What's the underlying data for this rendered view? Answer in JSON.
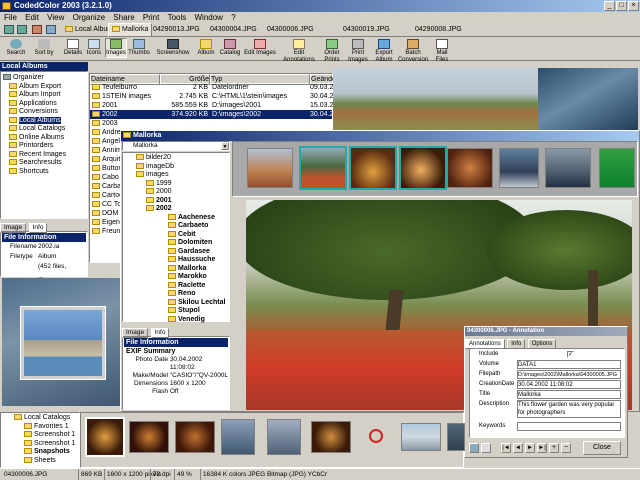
{
  "window": {
    "title": "CodedColor 2003 (3.2.1.0)"
  },
  "menu": [
    "File",
    "Edit",
    "View",
    "Organize",
    "Share",
    "Print",
    "Tools",
    "Window",
    "?"
  ],
  "tabs": [
    "Local Albums",
    "Mallorka",
    "04290013.JPG",
    "04300004.JPG",
    "04300006.JPG",
    "04300019.JPG",
    "04290008.JPG"
  ],
  "toolbar": {
    "buttons": [
      "Search",
      "Sort by",
      "Details",
      "Icons",
      "Images",
      "Thumbs",
      "Screenshow",
      "Album",
      "Catalog",
      "Edit Images",
      "Edit Annotations",
      "Order Prints",
      "Print Images",
      "Export Album",
      "Batch Conversion",
      "Mail Files"
    ]
  },
  "left": {
    "header": "Local Albums",
    "tree": [
      "Organizer",
      "Album Export",
      "Album Import",
      "Applications",
      "Conversions",
      "Local Albums",
      "Local Catalogs",
      "Online Albums",
      "Printorders",
      "Recent Images",
      "Searchresults",
      "Shortcuts"
    ],
    "tabs": [
      "Image",
      "Info"
    ],
    "info_header": "File Information",
    "info": [
      {
        "k": "Filename",
        "v": "2002.ia"
      },
      {
        "k": "Filetype",
        "v": "Album (452 files, ..."
      }
    ]
  },
  "filelist": {
    "columns": [
      "Dateiname",
      "Größe",
      "Typ",
      "Geände"
    ],
    "rows": [
      {
        "name": "Teufelburro",
        "size": "2 KB",
        "type": "Datelordner",
        "date": "09.03.2"
      },
      {
        "name": "1STEIN images",
        "size": "2.745 KB",
        "type": "C:\\HTML\\1\\stein\\images",
        "date": "30.04.2"
      },
      {
        "name": "2001",
        "size": "585.559 KB",
        "type": "D:\\images\\2001",
        "date": "15.03.2"
      },
      {
        "name": "2002",
        "size": "374.920 KB",
        "type": "D:\\images\\2002",
        "date": "30.04.2"
      },
      {
        "name": "2003",
        "size": "",
        "type": "",
        "date": ""
      },
      {
        "name": "Andrea",
        "size": "",
        "type": "",
        "date": ""
      },
      {
        "name": "Angels",
        "size": "",
        "type": "",
        "date": ""
      },
      {
        "name": "Annimation",
        "size": "",
        "type": "",
        "date": ""
      },
      {
        "name": "Arquitectura",
        "size": "",
        "type": "",
        "date": ""
      },
      {
        "name": "Buttons",
        "size": "",
        "type": "",
        "date": ""
      },
      {
        "name": "Cabo Verde",
        "size": "",
        "type": "",
        "date": ""
      },
      {
        "name": "Carbaseo",
        "size": "",
        "type": "",
        "date": ""
      },
      {
        "name": "Cartoons",
        "size": "",
        "type": "",
        "date": ""
      },
      {
        "name": "CC Tours",
        "size": "",
        "type": "",
        "date": ""
      },
      {
        "name": "DOM",
        "size": "",
        "type": "",
        "date": ""
      },
      {
        "name": "Eigene Bilder",
        "size": "",
        "type": "",
        "date": ""
      },
      {
        "name": "Freunde",
        "size": "",
        "type": "",
        "date": ""
      }
    ]
  },
  "mallorka": {
    "title": "Mallorka",
    "path": "Mallorka",
    "tree": [
      "bilder20",
      "imageDb",
      "images",
      "1999",
      "2000",
      "2001",
      "2002",
      "Aachenese",
      "Carbaeto",
      "Cebit",
      "Dolomiten",
      "Gardasee",
      "Haussuche",
      "Mallorka",
      "Marokko",
      "Raclette",
      "Reno",
      "Skilou Lechtal",
      "Stupol",
      "Venedig"
    ],
    "tabs": [
      "Image",
      "Info"
    ],
    "info_header": "File Information",
    "exif_header": "EXIF Summary",
    "exif": [
      {
        "k": "Photo Date",
        "v": "30.04.2002 11:08:02"
      },
      {
        "k": "Make/Model",
        "v": "\"CASIO\"/\"QV-2000L"
      },
      {
        "k": "Dimensions",
        "v": "1600 x 1200"
      },
      {
        "k": "Flash",
        "v": "Off"
      }
    ]
  },
  "dialog": {
    "title": "04300006.JPG - Annotation",
    "tabs": [
      "Annotations",
      "Info",
      "Options"
    ],
    "fields": [
      {
        "k": "Include",
        "v": ""
      },
      {
        "k": "Volume",
        "v": "DATA1"
      },
      {
        "k": "Filepath",
        "v": "D:\\images\\2002\\Mallorka\\04300005.JPG"
      },
      {
        "k": "CreationDate",
        "v": "30.04.2002 11:08:02"
      },
      {
        "k": "Title",
        "v": "Mallorka"
      },
      {
        "k": "Description",
        "v": "This flower garden was very popular for photographers"
      },
      {
        "k": "Keywords",
        "v": ""
      }
    ],
    "close": "Close"
  },
  "catalog": {
    "header": "Local Catalogs",
    "tree": [
      "Favorites 1",
      "Screenshot 1",
      "Screenshot 1",
      "Snapshots",
      "Sheets"
    ]
  },
  "status": [
    "04300006.JPG",
    "869 KB",
    "1600 x 1200 pixels",
    "72 dpi",
    "49 %",
    "16384 K colors JPEG Bitmap (JPG) YCbCr"
  ]
}
